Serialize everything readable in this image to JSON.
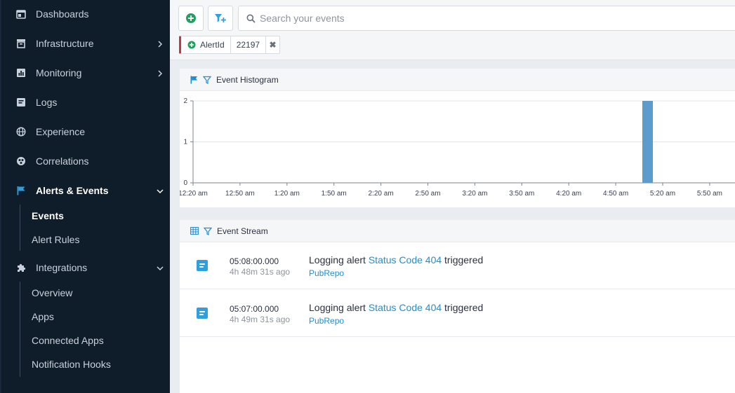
{
  "sidebar": {
    "items": [
      {
        "label": "Dashboards",
        "icon": "dashboard-icon",
        "has_chevron": false
      },
      {
        "label": "Infrastructure",
        "icon": "infrastructure-icon",
        "has_chevron": true
      },
      {
        "label": "Monitoring",
        "icon": "monitoring-icon",
        "has_chevron": true
      },
      {
        "label": "Logs",
        "icon": "logs-icon",
        "has_chevron": false
      },
      {
        "label": "Experience",
        "icon": "globe-icon",
        "has_chevron": false
      },
      {
        "label": "Correlations",
        "icon": "correlations-icon",
        "has_chevron": false
      },
      {
        "label": "Alerts & Events",
        "icon": "flag-icon",
        "has_chevron": true,
        "active": true
      },
      {
        "label": "Integrations",
        "icon": "puzzle-icon",
        "has_chevron": true
      }
    ],
    "alerts_sub": [
      {
        "label": "Events",
        "active": true
      },
      {
        "label": "Alert Rules"
      }
    ],
    "integrations_sub": [
      {
        "label": "Overview"
      },
      {
        "label": "Apps"
      },
      {
        "label": "Connected Apps"
      },
      {
        "label": "Notification Hooks"
      }
    ]
  },
  "toolbar": {
    "search_placeholder": "Search your events",
    "add_icon": "add-circle-icon",
    "filter_add_icon": "filter-plus-icon"
  },
  "filter_chip": {
    "key": "AlertId",
    "value": "22197",
    "close": "✖"
  },
  "histogram": {
    "title": "Event Histogram"
  },
  "chart_data": {
    "type": "bar",
    "title": "Event Histogram",
    "x_ticks": [
      "12:20 am",
      "12:50 am",
      "1:20 am",
      "1:50 am",
      "2:20 am",
      "2:50 am",
      "3:20 am",
      "3:50 am",
      "4:20 am",
      "4:50 am",
      "5:20 am",
      "5:50 am"
    ],
    "y_ticks": [
      0,
      1,
      2
    ],
    "ylim": [
      0,
      2
    ],
    "bars": [
      {
        "x": "5:07 am",
        "value": 2
      }
    ],
    "color": "#5b9ccc",
    "grid": true
  },
  "stream": {
    "title": "Event Stream",
    "events": [
      {
        "time": "05:08:00.000",
        "ago": "4h 48m 31s ago",
        "prefix": "Logging alert",
        "link": "Status Code 404",
        "suffix": "triggered",
        "source": "PubRepo"
      },
      {
        "time": "05:07:00.000",
        "ago": "4h 49m 31s ago",
        "prefix": "Logging alert",
        "link": "Status Code 404",
        "suffix": "triggered",
        "source": "PubRepo"
      }
    ]
  },
  "colors": {
    "sidebar_bg": "#0f1d2b",
    "accent": "#1f8fd1",
    "chip_border": "#c0394b",
    "add_green": "#22a060"
  }
}
